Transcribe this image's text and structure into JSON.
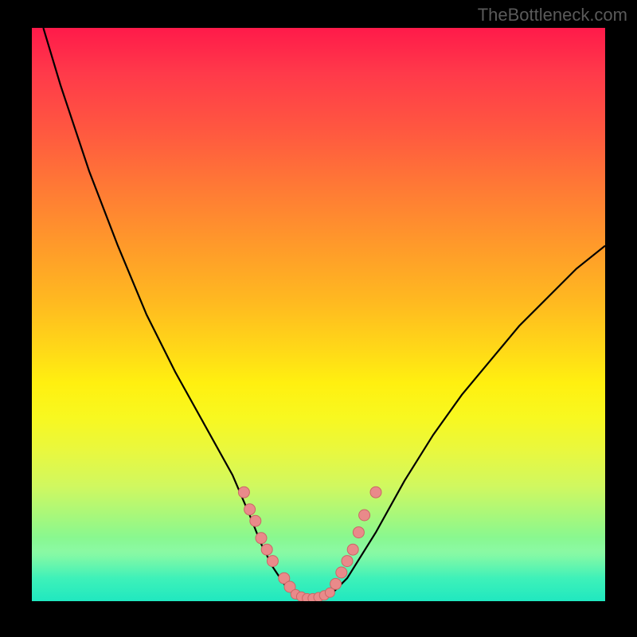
{
  "watermark": "TheBottleneck.com",
  "chart_data": {
    "type": "line",
    "title": "",
    "xlabel": "",
    "ylabel": "",
    "xlim": [
      0,
      100
    ],
    "ylim": [
      0,
      100
    ],
    "grid": false,
    "legend": false,
    "colors": {
      "background_gradient_top": "#ff1a4a",
      "background_gradient_bottom": "#20e8c0",
      "curve": "#000000",
      "marker_fill": "#e98a8a",
      "marker_stroke": "#cc6666"
    },
    "series": [
      {
        "name": "bottleneck-curve",
        "x": [
          2,
          5,
          10,
          15,
          20,
          25,
          30,
          35,
          38,
          40,
          42,
          44,
          46,
          48,
          50,
          52,
          55,
          60,
          65,
          70,
          75,
          80,
          85,
          90,
          95,
          100
        ],
        "values": [
          100,
          90,
          75,
          62,
          50,
          40,
          31,
          22,
          15,
          10,
          6,
          3,
          1,
          0,
          0,
          1,
          4,
          12,
          21,
          29,
          36,
          42,
          48,
          53,
          58,
          62
        ]
      }
    ],
    "markers": {
      "left_cluster": [
        {
          "x": 37,
          "y": 19
        },
        {
          "x": 38,
          "y": 16
        },
        {
          "x": 39,
          "y": 14
        },
        {
          "x": 40,
          "y": 11
        },
        {
          "x": 41,
          "y": 9
        },
        {
          "x": 42,
          "y": 7
        },
        {
          "x": 44,
          "y": 4
        },
        {
          "x": 45,
          "y": 2.5
        }
      ],
      "bottom_cluster": [
        {
          "x": 46,
          "y": 1.2
        },
        {
          "x": 47,
          "y": 0.8
        },
        {
          "x": 48,
          "y": 0.5
        },
        {
          "x": 49,
          "y": 0.5
        },
        {
          "x": 50,
          "y": 0.7
        },
        {
          "x": 51,
          "y": 1.0
        },
        {
          "x": 52,
          "y": 1.5
        }
      ],
      "right_cluster": [
        {
          "x": 53,
          "y": 3
        },
        {
          "x": 54,
          "y": 5
        },
        {
          "x": 55,
          "y": 7
        },
        {
          "x": 56,
          "y": 9
        },
        {
          "x": 57,
          "y": 12
        },
        {
          "x": 58,
          "y": 15
        },
        {
          "x": 60,
          "y": 19
        }
      ]
    }
  }
}
